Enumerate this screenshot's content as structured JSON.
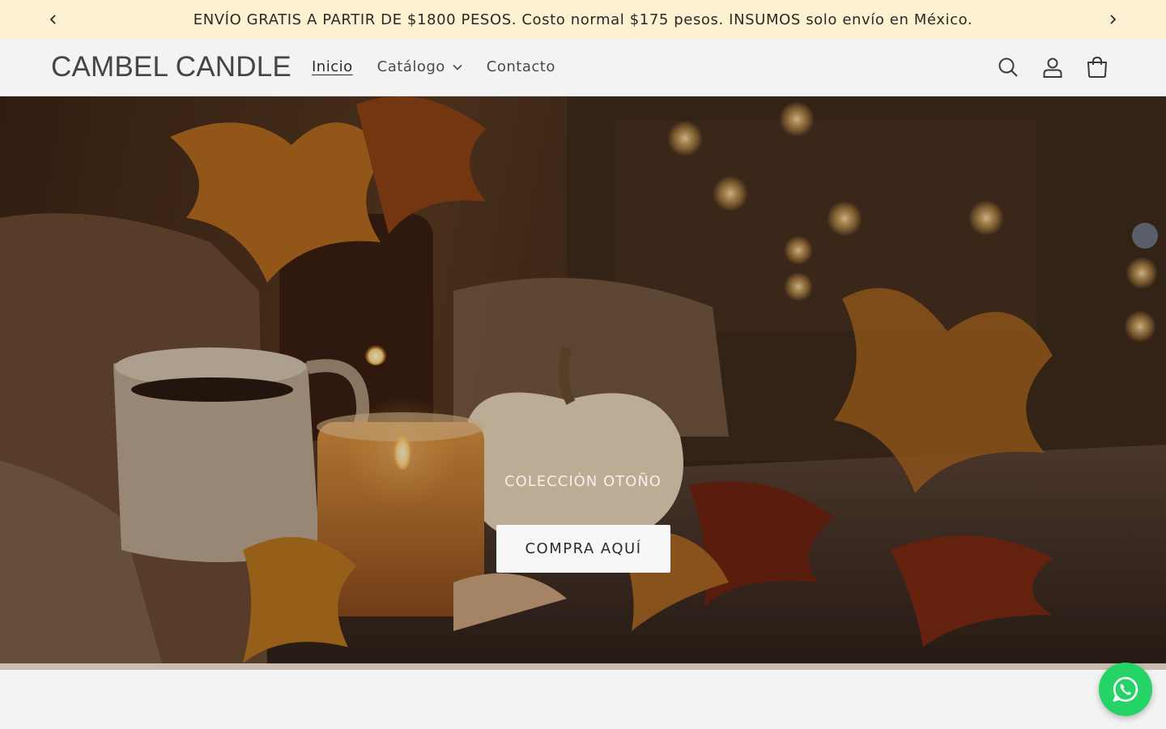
{
  "announcement": {
    "text": "ENVÍO GRATIS A PARTIR DE $1800 PESOS. Costo normal $175 pesos. INSUMOS solo envío en México.",
    "prev_icon": "chevron-left-icon",
    "next_icon": "chevron-right-icon"
  },
  "header": {
    "logo": "CAMBEL CANDLE",
    "nav": [
      {
        "label": "Inicio",
        "active": true
      },
      {
        "label": "Catálogo",
        "has_dropdown": true
      },
      {
        "label": "Contacto"
      }
    ],
    "icons": [
      "search-icon",
      "account-icon",
      "cart-icon"
    ]
  },
  "hero": {
    "subtitle": "COLECCIÓN OTOÑO",
    "button_label": "COMPRA AQUÍ"
  },
  "whatsapp": {
    "icon": "whatsapp-icon",
    "color": "#25d366"
  },
  "colors": {
    "announcement_bg": "#fcf1d2",
    "header_bg": "#f3f3f3",
    "accent": "#25d366"
  }
}
